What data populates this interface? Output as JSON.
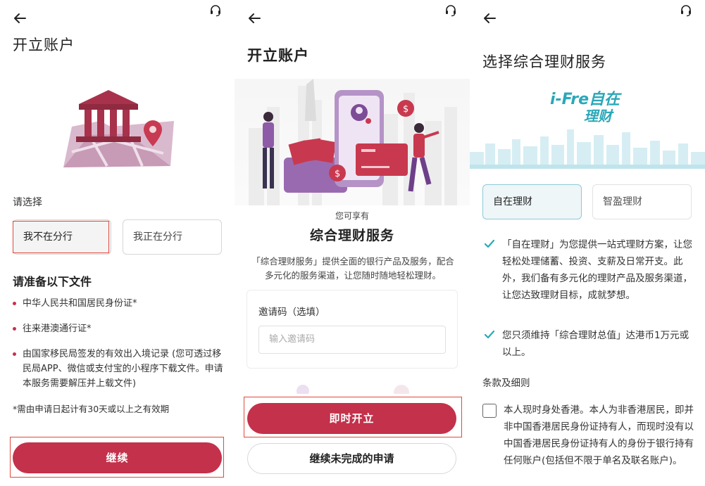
{
  "screen1": {
    "title": "开立账户",
    "select_label": "请选择",
    "options": [
      "我不在分行",
      "我正在分行"
    ],
    "documents_heading": "请准备以下文件",
    "documents": [
      "中华人民共和国居民身份证*",
      "往来港澳通行证*",
      "由国家移民局签发的有效出入境记录 (您可透过移民局APP、微信或支付宝的小程序下载文件。申请本服务需要解压并上载文件)"
    ],
    "note": "*需由申请日起计有30天或以上之有效期",
    "continue_button": "继续"
  },
  "screen2": {
    "title": "开立账户",
    "enjoy_label": "您可享有",
    "service_title": "综合理财服务",
    "service_desc": "「综合理财服务」提供全面的银行产品及服务，配合多元化的服务渠道，让您随时随地轻松理财。",
    "invite_label": "邀请码（选填）",
    "invite_placeholder": "输入邀请码",
    "open_now_button": "即时开立",
    "continue_incomplete_button": "继续未完成的申请"
  },
  "screen3": {
    "title": "选择综合理财服务",
    "brand_logo": "i-Free自在理财",
    "tabs": [
      "自在理财",
      "智盈理财"
    ],
    "benefits": [
      "「自在理财」为您提供一站式理财方案，让您轻松处理储蓄、投资、支薪及日常开支。此外，我们备有多元化的理财产品及服务渠道，让您达致理财目标，成就梦想。",
      "您只须维持「综合理财总值」达港币1万元或以上。"
    ],
    "terms_heading": "条款及细则",
    "terms_text": "本人现时身处香港。本人为非香港居民，即并非中国香港居民身份证持有人，而现时没有以中国香港居民身份证持有人的身份于银行持有任何账户(包括但不限于单名及联名账户)。"
  },
  "colors": {
    "primary": "#c4314b",
    "highlight_frame": "#e04a3c",
    "tick": "#2aa8b8",
    "tab_active_border": "#8fc9d7"
  },
  "icons": [
    "back-arrow-icon",
    "headset-icon",
    "bank-map-illustration",
    "finance-people-illustration",
    "skyline-illustration",
    "check-icon"
  ]
}
